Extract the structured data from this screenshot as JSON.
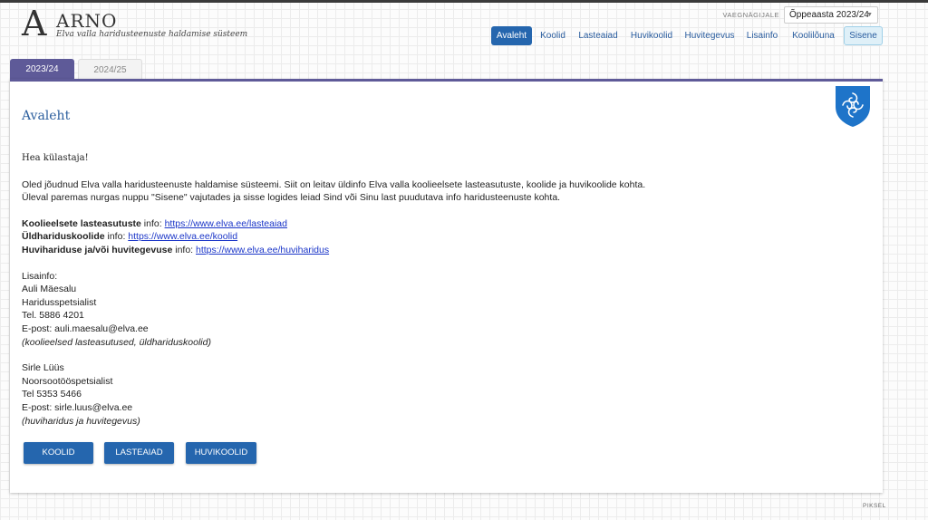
{
  "header": {
    "logo_letter": "A",
    "title": "ARNO",
    "subtitle": "Elva valla haridusteenuste haldamise süsteem",
    "view_label": "VAEGNÄGIJALE",
    "year_select": "Õppeaasta 2023/24"
  },
  "nav": {
    "items": [
      "Avaleht",
      "Koolid",
      "Lasteaiad",
      "Huvikoolid",
      "Huvitegevus",
      "Lisainfo",
      "Koolilõuna"
    ],
    "signin": "Sisene"
  },
  "tabs": [
    "2023/24",
    "2024/25"
  ],
  "main": {
    "title": "Avaleht",
    "greeting": "Hea külastaja!",
    "intro1": "Oled jõudnud Elva valla haridusteenuste haldamise süsteemi. Siit on leitav üldinfo Elva valla koolieelsete lasteasutuste, koolide ja huvikoolide kohta.",
    "intro2": "Üleval paremas nurgas nuppu \"Sisene\" vajutades ja sisse logides leiad Sind või Sinu last puudutava info haridusteenuste kohta.",
    "links": [
      {
        "bold": "Koolieelsete lasteasutuste",
        "mid": " info: ",
        "url": "https://www.elva.ee/lasteaiad"
      },
      {
        "bold": "Üldhariduskoolide",
        "mid": " info: ",
        "url": "https://www.elva.ee/koolid"
      },
      {
        "bold": "Huvihariduse ja/või huvitegevuse",
        "mid": " info: ",
        "url": "https://www.elva.ee/huviharidus"
      }
    ],
    "lisainfo_label": "Lisainfo:",
    "contact1": {
      "name": "Auli Mäesalu",
      "role": "Haridusspetsialist",
      "phone": "Tel. 5886 4201",
      "email": "E-post: auli.maesalu@elva.ee",
      "note": "(koolieelsed lasteasutused, üldhariduskoolid)"
    },
    "contact2": {
      "name": "Sirle Lüüs",
      "role": "Noorsootööspetsialist",
      "phone": "Tel 5353 5466",
      "email": "E-post: sirle.luus@elva.ee",
      "note": "(huviharidus ja huvitegevus)"
    },
    "buttons": [
      "KOOLID",
      "LASTEAIAD",
      "HUVIKOOLID"
    ]
  },
  "footer": {
    "brand": "PIKSEL"
  },
  "colors": {
    "accent": "#2566ae",
    "tab_purple": "#5e5a98",
    "crest": "#1e74c9"
  },
  "icons": {
    "crest": "elva-crest-icon"
  }
}
